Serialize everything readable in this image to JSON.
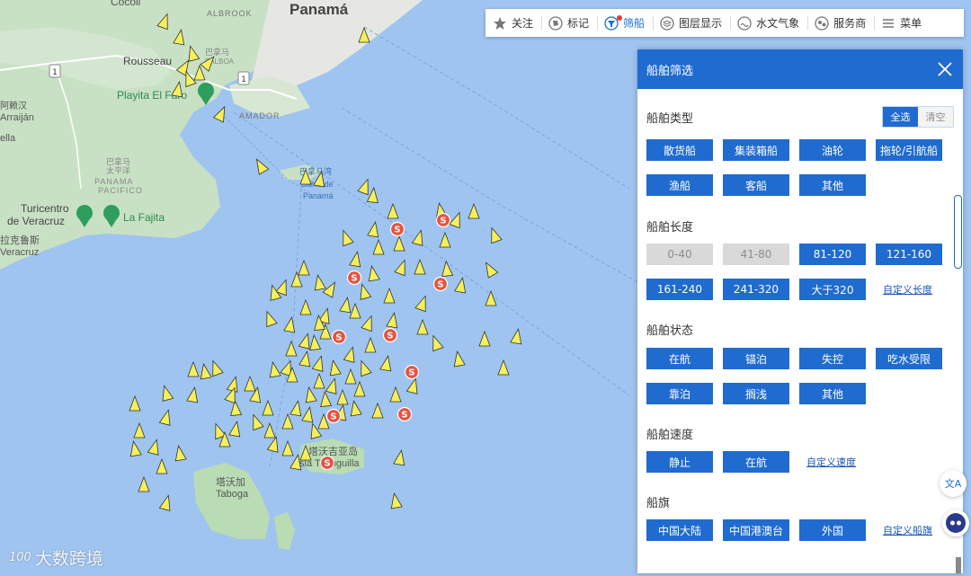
{
  "map": {
    "labels": {
      "cocoli": "Cocoli",
      "panama": "Panamá",
      "albrook": "ALBROOK",
      "balboa_cn": "巴拿马",
      "balboa": "BALBOA",
      "rousseau": "Rousseau",
      "playita": "Playita El Faro",
      "amador": "AMADOR",
      "arraijan_cn": "阿赖汉",
      "arraijan": "Arraiján",
      "ella": "ella",
      "pacifico_cn1": "巴拿马",
      "pacifico_cn2": "太平洋",
      "panama_pacifico1": "PANAMA",
      "panama_pacifico2": "PACIFICO",
      "bay_cn": "巴拿马湾",
      "bay1": "Bahia de",
      "bay2": "Panamá",
      "turicentro1": "Turicentro",
      "turicentro2": "de Veracruz",
      "fajita": "La Fajita",
      "veracruz_cn": "拉克鲁斯",
      "veracruz": "Veracruz",
      "taboga_cn": "塔沃加",
      "taboga": "Taboga",
      "taboguilla_cn": "塔沃吉亚岛",
      "taboguilla": "Isla Taboguilla",
      "road_1": "1"
    },
    "station_letter": "S"
  },
  "toolbar": {
    "items": [
      {
        "label": "关注",
        "icon": "star-icon"
      },
      {
        "label": "标记",
        "icon": "tag-icon"
      },
      {
        "label": "筛船",
        "icon": "filter-icon"
      },
      {
        "label": "图层显示",
        "icon": "layers-icon"
      },
      {
        "label": "水文气象",
        "icon": "weather-icon"
      },
      {
        "label": "服务商",
        "icon": "service-icon"
      },
      {
        "label": "菜单",
        "icon": "menu-icon"
      }
    ]
  },
  "panel": {
    "title": "船舶筛选",
    "select_all": "全选",
    "clear": "清空",
    "sections": {
      "type": {
        "title": "船舶类型",
        "row1": [
          "散货船",
          "集装箱船",
          "油轮",
          "拖轮/引航船"
        ],
        "row2": [
          "渔船",
          "客船",
          "其他"
        ]
      },
      "length": {
        "title": "船舶长度",
        "row1": [
          "0-40",
          "41-80",
          "81-120",
          "121-160"
        ],
        "row2": [
          "161-240",
          "241-320",
          "大于320"
        ],
        "link": "自定义长度"
      },
      "status": {
        "title": "船舶状态",
        "row1": [
          "在航",
          "锚泊",
          "失控",
          "吃水受限"
        ],
        "row2": [
          "靠泊",
          "搁浅",
          "其他"
        ]
      },
      "speed": {
        "title": "船舶速度",
        "row1": [
          "静止",
          "在航"
        ],
        "link": "自定义速度"
      },
      "flag": {
        "title": "船旗",
        "row1": [
          "中国大陆",
          "中国港澳台",
          "外国"
        ],
        "link": "自定义船旗"
      }
    }
  },
  "side": {
    "translate": "文A"
  },
  "watermark": {
    "text": "大数跨境",
    "logo": "100"
  },
  "colors": {
    "accent": "#1f6bd0",
    "ship": "#f5ef5a",
    "station": "#e8533f",
    "land": "#c9e2c5",
    "water": "#9fc4f0"
  }
}
